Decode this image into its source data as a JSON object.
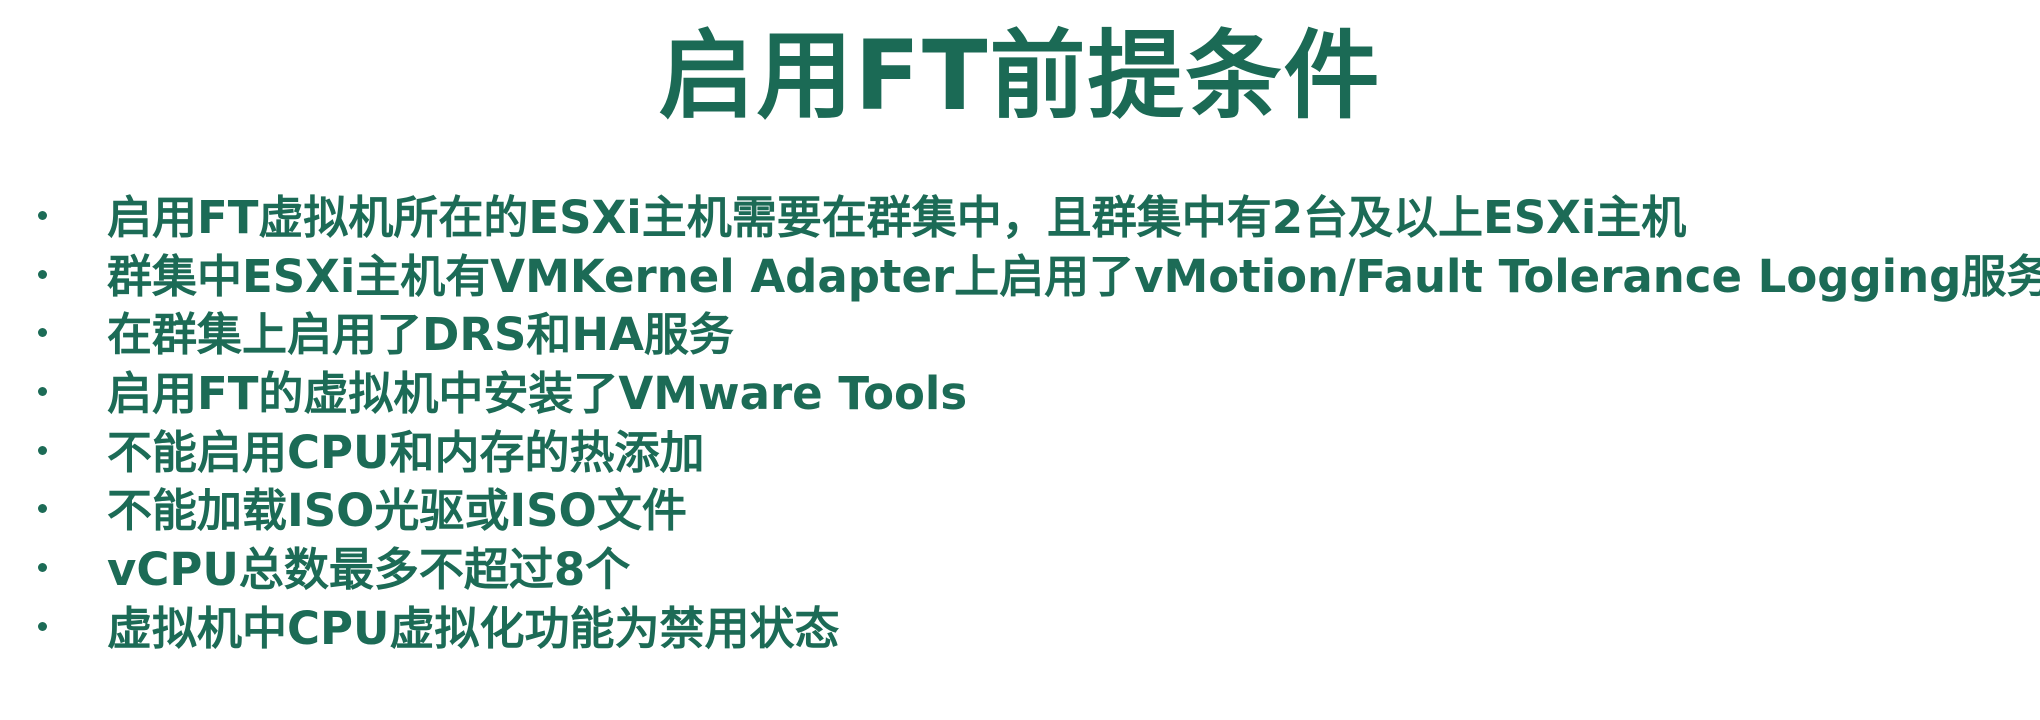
{
  "slide": {
    "title": "启用FT前提条件",
    "bullets": [
      "启用FT虚拟机所在的ESXi主机需要在群集中，且群集中有2台及以上ESXi主机",
      "群集中ESXi主机有VMKernel Adapter上启用了vMotion/Fault Tolerance Logging服务",
      "在群集上启用了DRS和HA服务",
      "启用FT的虚拟机中安装了VMware Tools",
      "不能启用CPU和内存的热添加",
      "不能加载ISO光驱或ISO文件",
      "vCPU总数最多不超过8个",
      "虚拟机中CPU虚拟化功能为禁用状态"
    ]
  },
  "colors": {
    "text": "#1c6b56",
    "background": "#ffffff"
  }
}
